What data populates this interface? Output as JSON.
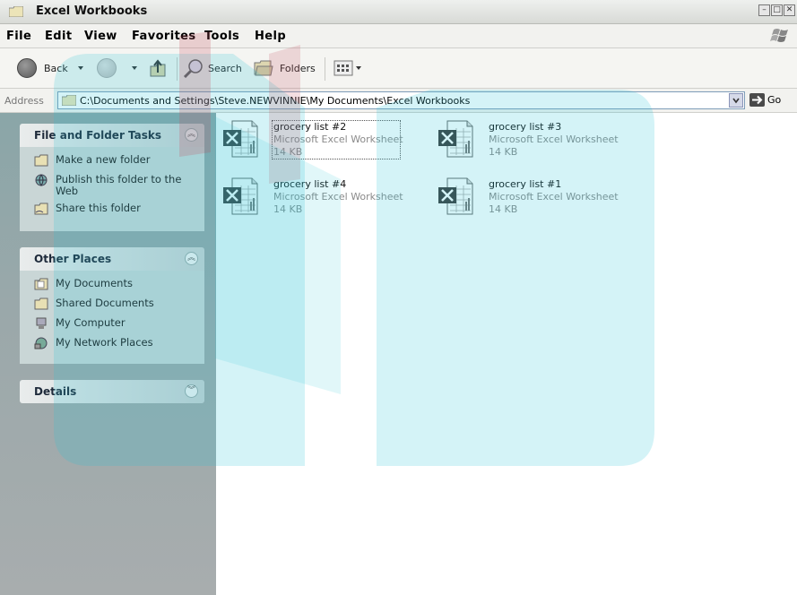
{
  "window": {
    "title": "Excel Workbooks",
    "buttons": [
      "–",
      "□",
      "✕"
    ]
  },
  "menubar": {
    "items": [
      "File",
      "Edit",
      "View",
      "Favorites",
      "Tools",
      "Help"
    ]
  },
  "toolbar": {
    "back": "Back",
    "search": "Search",
    "folders": "Folders"
  },
  "address": {
    "label": "Address",
    "path": "C:\\Documents and Settings\\Steve.NEWVINNIE\\My Documents\\Excel Workbooks",
    "go": "Go"
  },
  "leftpane": {
    "file_tasks": {
      "title": "File and Folder Tasks",
      "items": [
        "Make a new folder",
        "Publish this folder to the Web",
        "Share this folder"
      ]
    },
    "other_places": {
      "title": "Other Places",
      "items": [
        "My Documents",
        "Shared Documents",
        "My Computer",
        "My Network Places"
      ]
    },
    "details": {
      "title": "Details"
    }
  },
  "files": [
    {
      "name": "grocery list #2",
      "type": "Microsoft Excel Worksheet",
      "size": "14 KB",
      "selected": true
    },
    {
      "name": "grocery list #3",
      "type": "Microsoft Excel Worksheet",
      "size": "14 KB"
    },
    {
      "name": "grocery list #4",
      "type": "Microsoft Excel Worksheet",
      "size": "14 KB"
    },
    {
      "name": "grocery list #1",
      "type": "Microsoft Excel Worksheet",
      "size": "14 KB"
    }
  ],
  "colors": {
    "watermark": "#29c3d6",
    "watermark_red": "#c44a5a",
    "pane_header": "#1e2a3a"
  }
}
